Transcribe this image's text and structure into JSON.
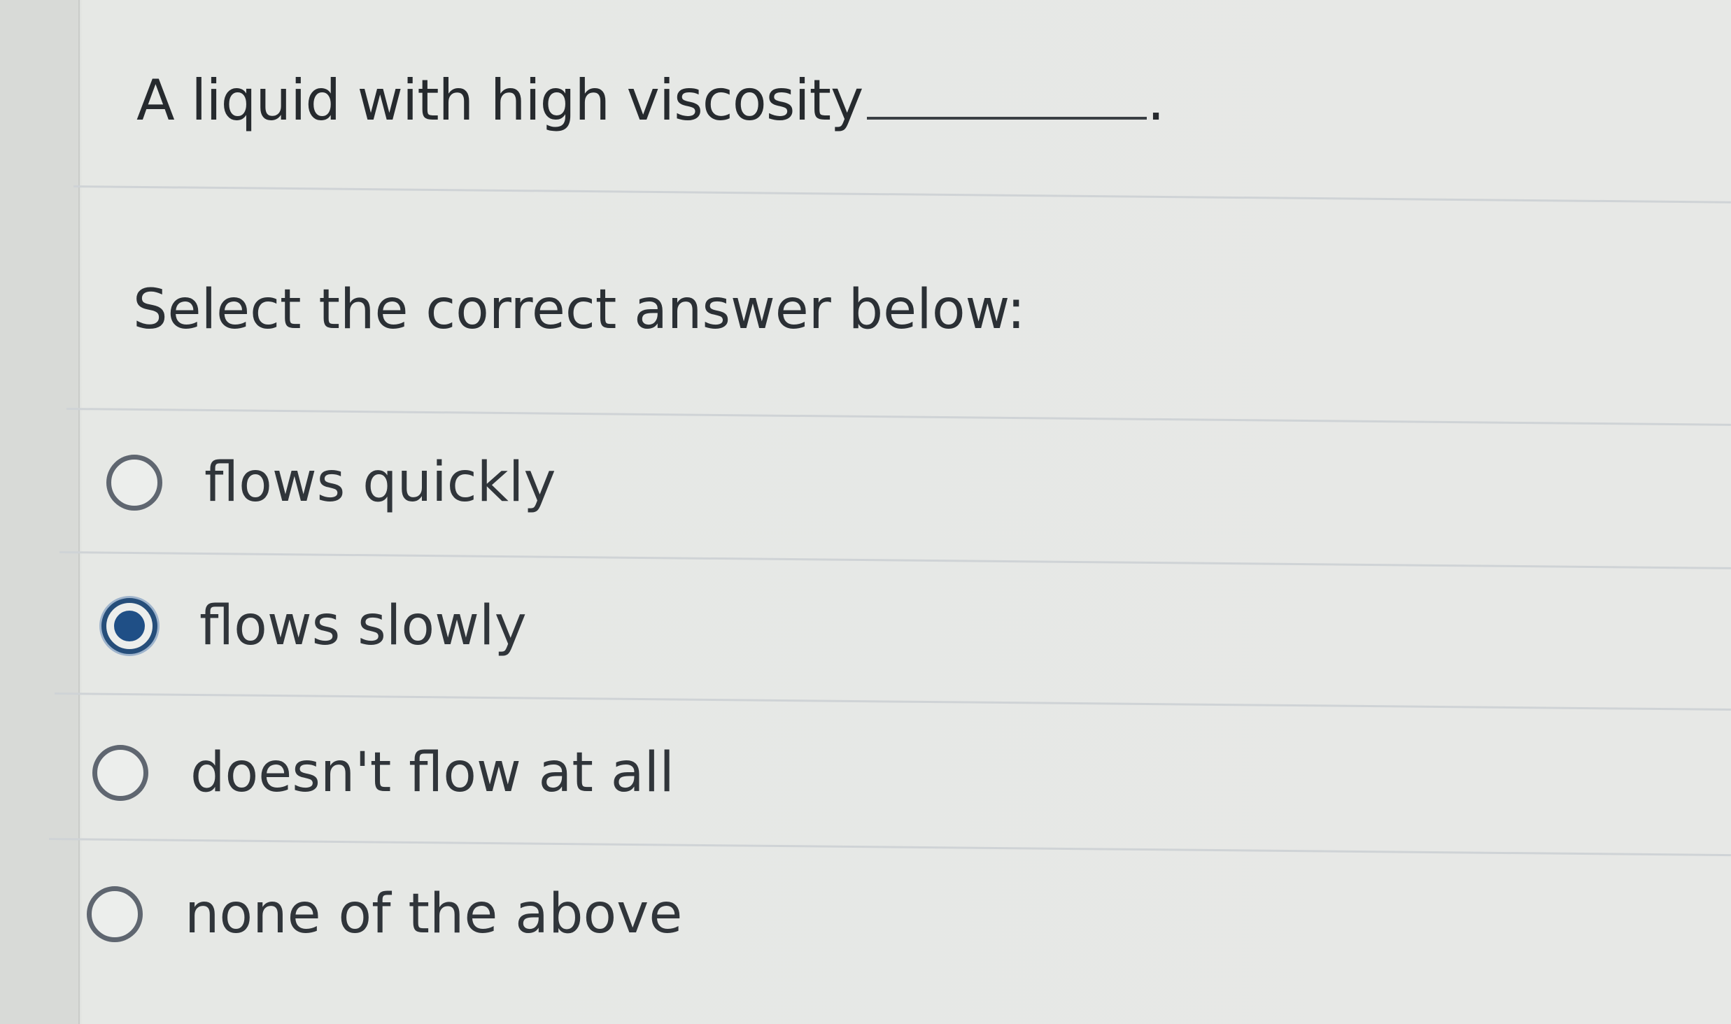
{
  "question": {
    "text": "A liquid with high viscosity",
    "suffix": "."
  },
  "prompt": "Select the correct answer below:",
  "options": [
    {
      "label": "flows quickly",
      "selected": false
    },
    {
      "label": "flows slowly",
      "selected": true
    },
    {
      "label": "doesn't flow at all",
      "selected": false
    },
    {
      "label": "none of the above",
      "selected": false
    }
  ],
  "colors": {
    "selected_radio": "#1f4f86",
    "radio_border": "#5f6670"
  }
}
